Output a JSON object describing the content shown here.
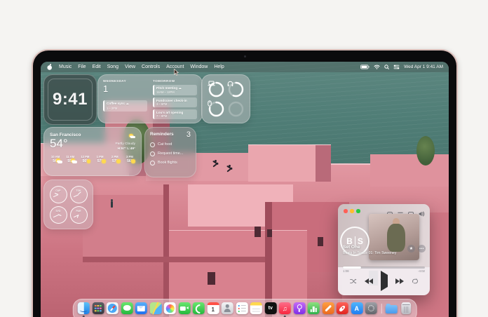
{
  "menubar": {
    "apple": "apple-logo",
    "items": [
      "Music",
      "File",
      "Edit",
      "Song",
      "View",
      "Controls",
      "Account",
      "Window",
      "Help"
    ],
    "status_icons": [
      "battery",
      "wifi",
      "search",
      "control-center"
    ],
    "datetime": "Wed Apr 1  9:41 AM"
  },
  "widgets": {
    "clock": {
      "time": "9:41"
    },
    "calendar": {
      "today_label": "WEDNESDAY",
      "date": "1",
      "today_events": [
        {
          "title": "Coffee sync",
          "time": "1 – 2PM"
        }
      ],
      "tomorrow_label": "TOMORROW",
      "tomorrow_events": [
        {
          "title": "Pitch meeting",
          "time": "11AM – 12PM"
        },
        {
          "title": "Fundraiser check-in",
          "time": "3 – 6PM"
        },
        {
          "title": "Lou's art opening",
          "time": "7 – 9PM"
        }
      ]
    },
    "batteries": {
      "devices": [
        "laptop",
        "headphones",
        "mouse",
        "empty"
      ],
      "levels": [
        93,
        56,
        78,
        0
      ]
    },
    "weather": {
      "city": "San Francisco",
      "temperature": "54°",
      "condition": "Partly Cloudy",
      "high_low": "H:57° L:49°",
      "hours": [
        {
          "time": "10 AM",
          "icon": "cloud-sun",
          "temp": "54°"
        },
        {
          "time": "11 AM",
          "icon": "cloud-sun",
          "temp": "55°"
        },
        {
          "time": "12 PM",
          "icon": "sun",
          "temp": "56°"
        },
        {
          "time": "1 PM",
          "icon": "sun",
          "temp": "57°"
        },
        {
          "time": "2 PM",
          "icon": "sun",
          "temp": "57°"
        },
        {
          "time": "3 PM",
          "icon": "sun",
          "temp": "56°"
        }
      ]
    },
    "reminders": {
      "title": "Reminders",
      "count": "3",
      "items": [
        "Cat food",
        "Request time...",
        "Book flights"
      ]
    },
    "world_clock": {
      "cities": [
        "CUP",
        "TOK",
        "SYD",
        "PAR"
      ]
    }
  },
  "music_player": {
    "logo_left": "B",
    "logo_right": "S",
    "track": "Set One",
    "album": "Beats In Space 01: Tim Sweeney",
    "elapsed": "1:08",
    "remaining": "-4:02",
    "progress_pct": 22,
    "star_glyph": "★",
    "more_glyph": "•••"
  },
  "dock": {
    "calendar_date": "1",
    "tv_label": "tv",
    "appstore_label": "A",
    "music_glyph": "♫",
    "icons": [
      "finder",
      "launchpad",
      "safari",
      "messages",
      "mail",
      "maps",
      "photos",
      "facetime",
      "phone",
      "calendar",
      "contacts",
      "reminders",
      "notes",
      "apple-tv",
      "music",
      "podcasts",
      "numbers",
      "pages",
      "rocket",
      "app-store",
      "settings",
      "folder",
      "trash"
    ]
  },
  "colors": {
    "water": "#55807a",
    "building_pink": "#dd8e99",
    "frost": "rgba(195,193,196,0.5)",
    "accent_red": "#fa233b"
  }
}
